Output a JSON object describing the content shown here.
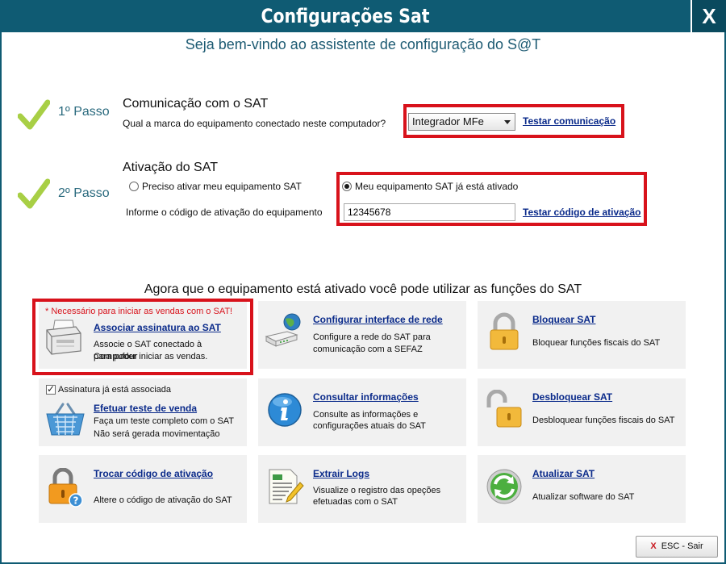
{
  "window": {
    "title": "Configurações Sat",
    "close_label": "X"
  },
  "welcome": "Seja bem-vindo ao assistente de configuração do S@T",
  "step1": {
    "label": "1º Passo",
    "title": "Comunicação com o SAT",
    "question": "Qual a marca do equipamento conectado neste computador?",
    "brand_selected": "Integrador MFe",
    "test_link": "Testar comunicação"
  },
  "step2": {
    "label": "2º Passo",
    "title": "Ativação do SAT",
    "radio_need": "Preciso ativar meu equipamento SAT",
    "radio_done": "Meu equipamento SAT já está ativado",
    "code_label": "Informe o código de ativação do equipamento",
    "code_value": "12345678",
    "test_link": "Testar código de ativação"
  },
  "functions_heading": "Agora que o equipamento está ativado você pode utilizar as funções do SAT",
  "tiles": {
    "associar": {
      "required_note": "* Necessário para iniciar as vendas com o SAT!",
      "link": "Associar assinatura ao SAT",
      "desc1": "Associe o SAT conectado à Compufour",
      "desc2": "para poder iniciar as vendas."
    },
    "configurar": {
      "link": "Configurar interface de rede",
      "desc1": "Configure a rede do SAT para",
      "desc2": "comunicação com a SEFAZ"
    },
    "bloquear": {
      "link": "Bloquear SAT",
      "desc1": "Bloquear funções fiscais do SAT"
    },
    "teste": {
      "checkbox_label": "Assinatura já está associada",
      "link": "Efetuar teste de venda",
      "desc1": "Faça um teste completo com o SAT",
      "desc2": "Não será gerada movimentação"
    },
    "consultar": {
      "link": "Consultar informações",
      "desc1": "Consulte as informações e",
      "desc2": "configurações atuais do SAT"
    },
    "desbloquear": {
      "link": "Desbloquear SAT",
      "desc1": "Desbloquear funções fiscais do SAT"
    },
    "trocar": {
      "link": "Trocar código de ativação",
      "desc1": "Altere o código de ativação do SAT"
    },
    "logs": {
      "link": "Extrair Logs",
      "desc1": "Visualize o registro das opeções",
      "desc2": "efetuadas com o SAT"
    },
    "atualizar": {
      "link": "Atualizar SAT",
      "desc1": "Atualizar software do SAT"
    }
  },
  "esc_button": {
    "icon": "X",
    "label": "ESC - Sair"
  },
  "colors": {
    "titlebar": "#0f5b73",
    "highlight": "#d8121b",
    "link": "#0a2a8a",
    "check": "#a8cf45"
  }
}
